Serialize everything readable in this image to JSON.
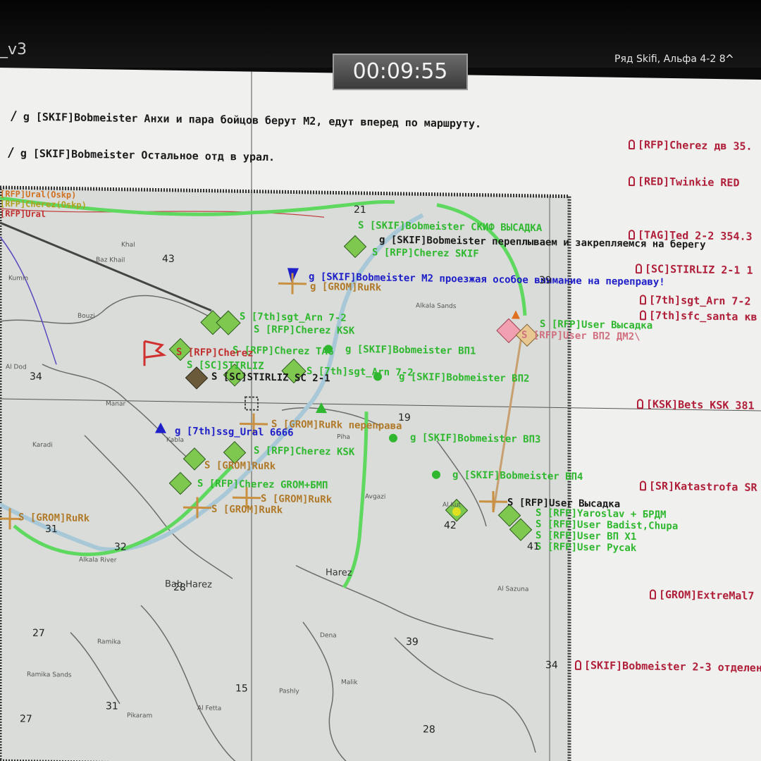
{
  "window": {
    "title": "_v3",
    "timer": "00:09:55",
    "squad": "Ряд Skifi, Альфа 4-2 8",
    "squad_toggle": "^"
  },
  "chat": [
    {
      "text": "g [SKIF]Bobmeister Анхи и пара бойцов берут M2, едут вперед по маршруту."
    },
    {
      "text": "g [SKIF]Bobmeister Остальное отд в урал."
    }
  ],
  "players": [
    {
      "text": "[RFP]Cherez дв 35."
    },
    {
      "text": "[RED]Twinkie RED"
    },
    {
      "text": "[TAG]Ted 2-2 354.3"
    },
    {
      "text": "[SC]STIRLIZ 2-1   1"
    },
    {
      "text": "[7th]sgt_Arn 7-2"
    },
    {
      "text": "[7th]sfc_santa кв"
    },
    {
      "text": "[KSK]Bets KSK 381"
    },
    {
      "text": "[SR]Katastrofa SR"
    },
    {
      "text": "[GROM]ExtreMal7"
    },
    {
      "text": "[SKIF]Bobmeister 2-3 отделен"
    }
  ],
  "map_labels": {
    "skif_landing": "S [SKIF]Bobmeister СКИФ ВЫСАДКА",
    "swim_note": "g [SKIF]Bobmeister переплываем и закрепляемся на берегу",
    "cherez_skif": "S [RFP]Cherez SKIF",
    "m2_note": "g [SKIF]Bobmeister M2 проезжая особое внимание на переправу!",
    "grom_rurk_top": "g [GROM]RuRk",
    "arn": "S [7th]sgt_Arn 7-2",
    "cherez_ksk": "S [RFP]Cherez KSK",
    "cherez_tag": "S [RFP]Cherez TAG",
    "cherez_red": "S [RFP]Cherez",
    "stirliz": "S [SC]STIRLIZ",
    "stirliz2": "S [SC]STIRLIZ SC 2-1",
    "arn_2": "S [7th]sgt_Arn 7-2",
    "vp1": "g [SKIF]Bobmeister ВП1",
    "vp2": "g [SKIF]Bobmeister ВП2",
    "vp3": "g [SKIF]Bobmeister ВП3",
    "vp4": "g [SKIF]Bobmeister ВП4",
    "ural": "g [7th]ssg_Ural 6666",
    "grom_crossing": "S [GROM]RuRk переправа",
    "cherez_ksk2": "S [RFP]Cherez KSK",
    "grom_rurk2": "S [GROM]RuRk",
    "cherez_grom": "S [RFP]Cherez GROM+БМП",
    "grom_rurk3": "S [GROM]RuRk",
    "grom_rurk4": "S [GROM]RuRk",
    "grom_rurk5": "S [GROM]RuRk",
    "user_landing": "S [RFP]User Высадка",
    "user_dm2": "S [RFP]User ВП2 ДМ2\\",
    "user_landing2": "S [RFP]User Высадка",
    "yaroslav": "S [RFP]Yaroslav + БРДМ",
    "badist": "S [RFP]User Badist,Chupa",
    "x1": "S [RFP]User ВП X1",
    "pycak": "S [RFP]User Pycak",
    "top_left_1": "[RFP]Ural(Oskp)",
    "top_left_2": "[RFP]Cherez(Oskp)",
    "top_left_3": "[RFP]Ural"
  },
  "grid_numbers": [
    "21",
    "43",
    "39",
    "34",
    "19",
    "31",
    "32",
    "42",
    "41",
    "27",
    "39",
    "15",
    "31",
    "27",
    "28",
    "34",
    "28"
  ],
  "towns": [
    "Baz Khail",
    "Khal",
    "Kumin",
    "Bouzi",
    "Al Dod",
    "Manar",
    "Karadi",
    "Kabla",
    "Piha",
    "Alkala Sands",
    "Avgazi",
    "Al Kut",
    "Alkala River",
    "Ramika",
    "Ramika Sands",
    "Pikaram",
    "Al Fetta",
    "Pashly",
    "Malik",
    "Dena",
    "Al Sazuna",
    "Bab Harez",
    "Harez"
  ],
  "colors": {
    "friendly": "#2fb82f",
    "chat_blue": "#1e1ec8",
    "player_red": "#b0203a",
    "grom": "#b07a2a",
    "route_green": "#5fd85f"
  }
}
